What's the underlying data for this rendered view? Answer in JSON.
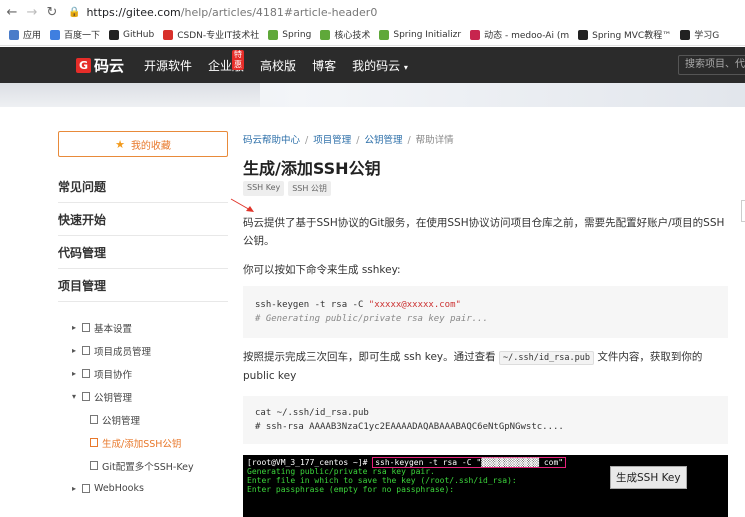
{
  "browser": {
    "url_host": "https://gitee.com",
    "url_path": "/help/articles/4181#article-header0",
    "bookmarks": [
      {
        "label": "应用",
        "icon": "apps-grid-icon",
        "color": "#4a7cc9"
      },
      {
        "label": "百度一下",
        "icon": "baidu-icon",
        "color": "#3f7fe0"
      },
      {
        "label": "GitHub",
        "icon": "github-icon",
        "color": "#222222"
      },
      {
        "label": "CSDN-专业IT技术社",
        "icon": "csdn-icon",
        "color": "#d8302b"
      },
      {
        "label": "Spring",
        "icon": "spring-icon",
        "color": "#5fa83a"
      },
      {
        "label": "核心技术",
        "icon": "spring-icon",
        "color": "#5fa83a"
      },
      {
        "label": "Spring Initializr",
        "icon": "spring-icon",
        "color": "#5fa83a"
      },
      {
        "label": "动态 - medoo-Ai (m",
        "icon": "gitee-icon",
        "color": "#c7254e"
      },
      {
        "label": "Spring MVC教程™",
        "icon": "b-icon",
        "color": "#222222"
      },
      {
        "label": "学习G",
        "icon": "github-icon",
        "color": "#222222"
      }
    ]
  },
  "header": {
    "logo": "码云",
    "nav": [
      "开源软件",
      "企业版",
      "高校版",
      "博客",
      "我的码云"
    ],
    "hot_badge": "特惠",
    "search_placeholder": "搜索项目、代"
  },
  "sidebar": {
    "favorites": "我的收藏",
    "sections": [
      "常见问题",
      "快速开始",
      "代码管理",
      "项目管理"
    ],
    "tree": [
      {
        "label": "基本设置",
        "level": 0,
        "expanded": false
      },
      {
        "label": "项目成员管理",
        "level": 0,
        "expanded": false
      },
      {
        "label": "项目协作",
        "level": 0,
        "expanded": false
      },
      {
        "label": "公钥管理",
        "level": 0,
        "expanded": true
      },
      {
        "label": "公钥管理",
        "level": 1
      },
      {
        "label": "生成/添加SSH公钥",
        "level": 1,
        "active": true
      },
      {
        "label": "Git配置多个SSH-Key",
        "level": 1
      },
      {
        "label": "WebHooks",
        "level": 0,
        "expanded": false
      }
    ]
  },
  "article": {
    "breadcrumb": [
      "码云帮助中心",
      "项目管理",
      "公钥管理",
      "帮助详情"
    ],
    "title": "生成/添加SSH公钥",
    "tags": [
      "SSH Key",
      "SSH 公钥"
    ],
    "para1": "码云提供了基于SSH协议的Git服务，在使用SSH协议访问项目仓库之前，需要先配置好账户/项目的SSH公钥。",
    "para2": "你可以按如下命令来生成 sshkey:",
    "code1_cmd": "ssh-keygen -t rsa -C ",
    "code1_str": "\"xxxxx@xxxxx.com\"",
    "code1_comment": "# Generating public/private rsa key pair...",
    "para3_a": "按照提示完成三次回车，即可生成 ssh key。通过查看 ",
    "para3_code": "~/.ssh/id_rsa.pub",
    "para3_b": " 文件内容，获取到你的 public key",
    "code2_l1": "cat ~/.ssh/id_rsa.pub",
    "code2_l2": "# ssh-rsa AAAAB3NzaC1yc2EAAAADAQABAAABAQC6eNtGpNGwstc....",
    "terminal": {
      "prompt": "[root@VM_3_177_centos ~]# ",
      "cmd": "ssh-keygen -t rsa -C \"",
      "cmd_end": " com\"",
      "line2": "Generating public/private rsa key pair.",
      "line3": "Enter file in which to save the key (/root/.ssh/id_rsa):",
      "line4": "Enter passphrase (empty for no passphrase):"
    },
    "terminal_label": "生成SSH Key"
  }
}
